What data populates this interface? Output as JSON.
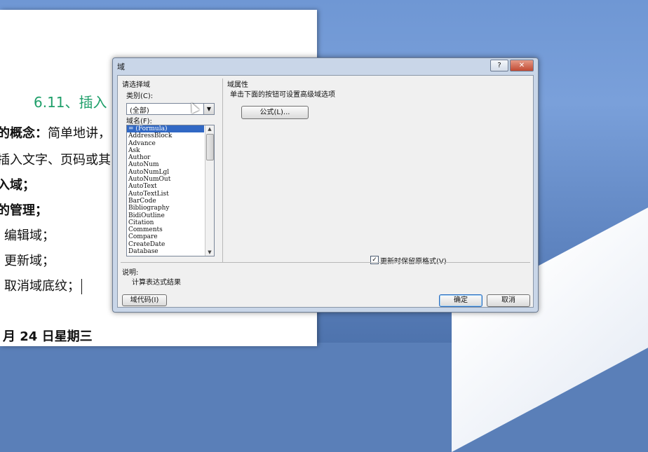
{
  "document": {
    "heading": "6.11、插入",
    "lines": [
      {
        "bold": "的概念：",
        "text": "简单地讲，"
      },
      {
        "bold": "",
        "text": "插入文字、页码或其"
      },
      {
        "bold": "入域；",
        "text": ""
      },
      {
        "bold": "的管理；",
        "text": ""
      },
      {
        "bold": "",
        "text": "编辑域；"
      },
      {
        "bold": "",
        "text": "更新域；"
      },
      {
        "bold": "",
        "text": "取消域底纹；"
      }
    ],
    "date_line": "月 24 日星期三"
  },
  "dialog": {
    "title": "域",
    "help_label": "?",
    "close_label": "✕",
    "choose_field_label": "请选择域",
    "category_label": "类别(C):",
    "category_value": "(全部)",
    "field_names_label": "域名(F):",
    "field_names": [
      "= (Formula)",
      "AddressBlock",
      "Advance",
      "Ask",
      "Author",
      "AutoNum",
      "AutoNumLgl",
      "AutoNumOut",
      "AutoText",
      "AutoTextList",
      "BarCode",
      "Bibliography",
      "BidiOutline",
      "Citation",
      "Comments",
      "Compare",
      "CreateDate",
      "Database"
    ],
    "selected_field": "= (Formula)",
    "field_properties_label": "域属性",
    "hint_text": "单击下面的按钮可设置高级域选项",
    "formula_button": "公式(L)...",
    "preserve_format_label": "更新时保留原格式(V)",
    "preserve_format_checked": true,
    "description_label": "说明:",
    "description_text": "计算表达式结果",
    "field_codes_button": "域代码(I)",
    "ok_button": "确定",
    "cancel_button": "取消"
  },
  "colors": {
    "heading": "#1f9f6a",
    "selection": "#3168c4",
    "close_button": "#c14a33"
  },
  "icons": [
    "chevron-down-icon",
    "scroll-up-icon",
    "scroll-down-icon",
    "check-icon",
    "mouse-cursor-icon"
  ]
}
